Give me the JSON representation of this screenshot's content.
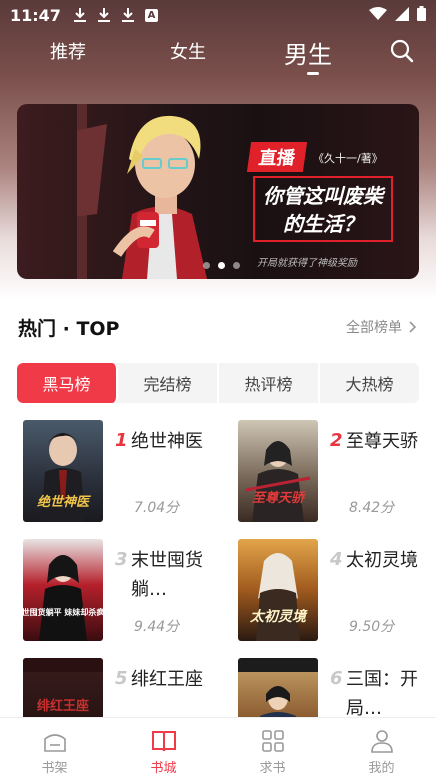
{
  "status": {
    "time": "11:47",
    "a_label": "A"
  },
  "top_tabs": [
    {
      "label": "推荐"
    },
    {
      "label": "女生"
    },
    {
      "label": "男生",
      "active": true
    }
  ],
  "banner": {
    "badge": "直播",
    "author": "《久十一/著》",
    "title": "你管这叫废柴的生活？",
    "subtitle": "开局就获得了神级奖励",
    "page_index": 1,
    "page_count": 3
  },
  "section": {
    "title": "热门 · TOP",
    "more": "全部榜单"
  },
  "rank_tabs": [
    {
      "label": "黑马榜",
      "active": true
    },
    {
      "label": "完结榜"
    },
    {
      "label": "热评榜"
    },
    {
      "label": "大热榜"
    }
  ],
  "books": [
    {
      "rank": "1",
      "title": "绝世神医",
      "score": "7.04分",
      "cover_text": "绝世神医"
    },
    {
      "rank": "2",
      "title": "至尊天骄",
      "score": "8.42分",
      "cover_text": "至尊天骄"
    },
    {
      "rank": "3",
      "title": "末世囤货躺…",
      "score": "9.44分",
      "cover_text": "末世囤货躺平 妹妹却杀疯了"
    },
    {
      "rank": "4",
      "title": "太初灵境",
      "score": "9.50分",
      "cover_text": "太初灵境"
    },
    {
      "rank": "5",
      "title": "绯红王座",
      "score": "",
      "cover_text": "绯红王座"
    },
    {
      "rank": "6",
      "title": "三国：开局…",
      "score": "",
      "cover_text": ""
    }
  ],
  "bottom_nav": [
    {
      "label": "书架",
      "icon": "bookshelf-icon"
    },
    {
      "label": "书城",
      "icon": "open-book-icon",
      "active": true
    },
    {
      "label": "求书",
      "icon": "grid-icon"
    },
    {
      "label": "我的",
      "icon": "person-icon"
    }
  ],
  "colors": {
    "accent": "#f03a47",
    "header_top": "#5a3a3a"
  }
}
